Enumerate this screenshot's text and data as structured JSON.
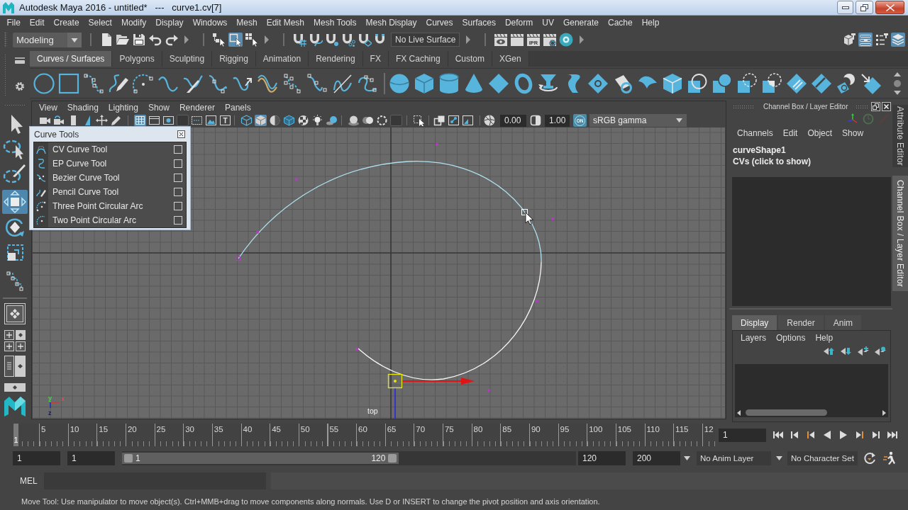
{
  "window": {
    "title": "Autodesk Maya 2016 - untitled*   ---   curve1.cv[7]"
  },
  "menu_bar": [
    "File",
    "Edit",
    "Create",
    "Select",
    "Modify",
    "Display",
    "Windows",
    "Mesh",
    "Edit Mesh",
    "Mesh Tools",
    "Mesh Display",
    "Curves",
    "Surfaces",
    "Deform",
    "UV",
    "Generate",
    "Cache",
    "Help"
  ],
  "status_line": {
    "menu_set": "Modeling",
    "selection_modes": [
      {
        "kind": "hierarchy",
        "selected": false
      },
      {
        "kind": "object",
        "selected": true
      },
      {
        "kind": "component",
        "selected": false
      }
    ],
    "live_surface": "No Live Surface",
    "ipr_label": "IPR",
    "panel_toggles": [
      {
        "kind": "modeling_toolkit",
        "on": false
      },
      {
        "kind": "attribute_editor",
        "on": true
      },
      {
        "kind": "tool_settings",
        "on": false
      },
      {
        "kind": "channel_box",
        "on": true
      }
    ]
  },
  "shelf": {
    "tabs": [
      {
        "label": "Curves / Surfaces",
        "selected": true
      },
      {
        "label": "Polygons",
        "selected": false
      },
      {
        "label": "Sculpting",
        "selected": false
      },
      {
        "label": "Rigging",
        "selected": false
      },
      {
        "label": "Animation",
        "selected": false
      },
      {
        "label": "Rendering",
        "selected": false
      },
      {
        "label": "FX",
        "selected": false
      },
      {
        "label": "FX Caching",
        "selected": false
      },
      {
        "label": "Custom",
        "selected": false
      },
      {
        "label": "XGen",
        "selected": false
      }
    ]
  },
  "toolbox": {
    "tools": [
      {
        "kind": "select",
        "selected": false
      },
      {
        "kind": "lasso",
        "selected": false
      },
      {
        "kind": "paint",
        "selected": false
      },
      {
        "kind": "move",
        "selected": true
      },
      {
        "kind": "rotate",
        "selected": false
      },
      {
        "kind": "scale",
        "selected": false
      },
      {
        "kind": "last_tool",
        "selected": false
      }
    ]
  },
  "viewport": {
    "menus": [
      "View",
      "Shading",
      "Lighting",
      "Show",
      "Renderer",
      "Panels"
    ],
    "toolbar": [
      {
        "kind": "camera",
        "on": false
      },
      {
        "kind": "camera_lock",
        "on": false
      },
      {
        "kind": "bookmark",
        "on": false
      },
      {
        "kind": "image_plane",
        "on": false
      },
      {
        "kind": "pan_2d",
        "on": false
      },
      {
        "kind": "grease_pencil",
        "on": false
      },
      {
        "kind": "grid",
        "on": true
      },
      {
        "kind": "film_gate",
        "on": false
      },
      {
        "kind": "resolution_gate",
        "on": false
      },
      {
        "kind": "gate_mask",
        "on": false
      },
      {
        "kind": "field_chart",
        "on": false
      },
      {
        "kind": "safe_action",
        "on": false
      },
      {
        "kind": "safe_title",
        "on": false,
        "label": "T"
      },
      {
        "kind": "wireframe",
        "on": false
      },
      {
        "kind": "smooth_shade",
        "on": true
      },
      {
        "kind": "flat_shade",
        "on": false
      },
      {
        "kind": "wireframe_on_shaded",
        "on": false
      },
      {
        "kind": "textures",
        "on": false
      },
      {
        "kind": "lights",
        "on": false
      },
      {
        "kind": "shadows",
        "on": false
      },
      {
        "kind": "ambient_occlusion",
        "on": false
      },
      {
        "kind": "motion_blur",
        "on": false
      },
      {
        "kind": "anti_aliasing",
        "on": false
      },
      {
        "kind": "depth_of_field",
        "on": false
      },
      {
        "kind": "isolate",
        "on": false
      },
      {
        "kind": "xray",
        "on": false
      },
      {
        "kind": "xray_joints",
        "on": false
      },
      {
        "kind": "xray_components",
        "on": false
      }
    ],
    "exposure": "0.00",
    "gamma": "1.00",
    "color_management": "ON",
    "color_space": "sRGB gamma",
    "axis_labels": [
      "y",
      "x",
      "z"
    ],
    "camera": "top"
  },
  "curve_tools": {
    "title": "Curve Tools",
    "items": [
      "CV Curve Tool",
      "EP Curve Tool",
      "Bezier Curve Tool",
      "Pencil Curve Tool",
      "Three Point Circular Arc",
      "Two Point Circular Arc"
    ]
  },
  "channel_box": {
    "title": "Channel Box / Layer Editor",
    "menus": [
      "Channels",
      "Edit",
      "Object",
      "Show"
    ],
    "node": "curveShape1",
    "components": "CVs (click to show)",
    "layer_tabs": [
      {
        "label": "Display",
        "selected": true
      },
      {
        "label": "Render",
        "selected": false
      },
      {
        "label": "Anim",
        "selected": false
      }
    ],
    "layer_menus": [
      "Layers",
      "Options",
      "Help"
    ]
  },
  "side_tabs": [
    {
      "label": "Attribute Editor",
      "selected": false
    },
    {
      "label": "Channel Box / Layer Editor",
      "selected": true
    }
  ],
  "time_slider": {
    "labels": [
      "5",
      "10",
      "15",
      "20",
      "25",
      "30",
      "35",
      "40",
      "45",
      "50",
      "55",
      "60",
      "65",
      "70",
      "75",
      "80",
      "85",
      "90",
      "95",
      "100",
      "105",
      "110",
      "115",
      "12"
    ],
    "current_frame": "1",
    "level": 0,
    "current_time": "1"
  },
  "range_slider": {
    "start": "1",
    "playback_start": "1",
    "range_start": "1",
    "range_end": "120",
    "level": 0.61,
    "playback_end": "120",
    "end": "200",
    "anim_layer": "No Anim Layer",
    "character_set": "No Character Set"
  },
  "command_line": {
    "language": "MEL"
  },
  "help_line": "Move Tool: Use manipulator to move object(s). Ctrl+MMB+drag to move components along normals. Use D or INSERT to change the pivot position and axis orientation."
}
